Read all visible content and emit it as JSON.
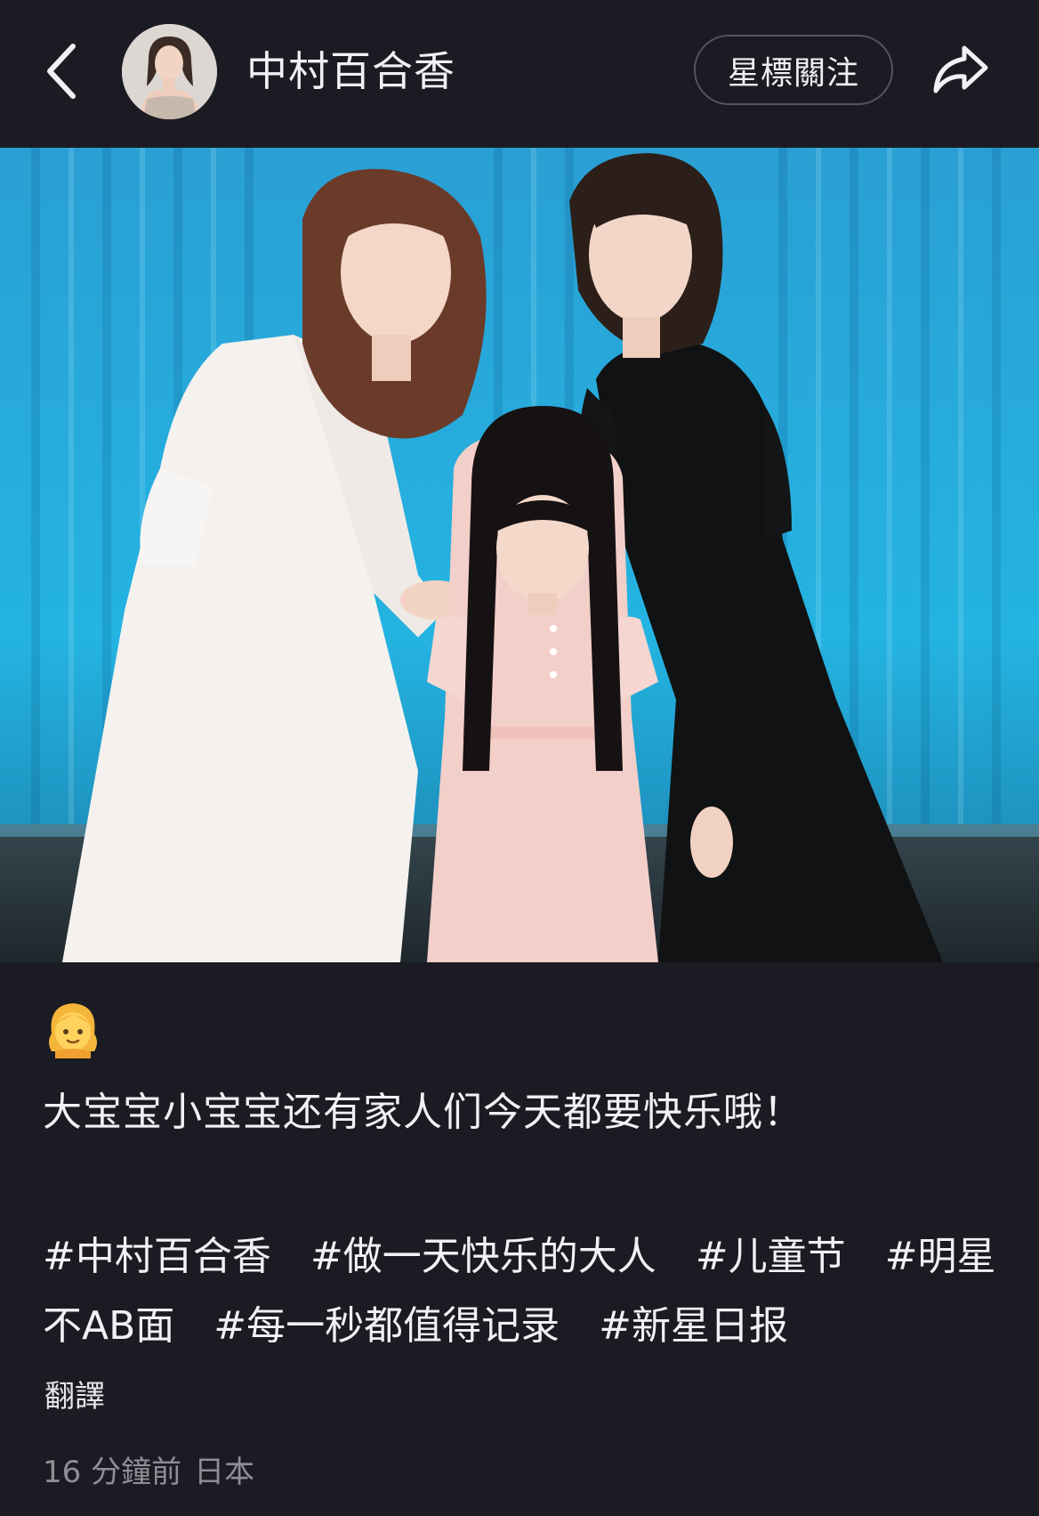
{
  "header": {
    "author_name": "中村百合香",
    "follow_label": "星標關注",
    "back_icon": "chevron-left-icon",
    "share_icon": "share-arrow-icon"
  },
  "post": {
    "emoji": "girl-emoji",
    "caption": "大宝宝小宝宝还有家人们今天都要快乐哦！",
    "tags": [
      "#中村百合香",
      "#做一天快乐的大人",
      "#儿童节",
      "#明星不AB面",
      "#每一秒都值得记录",
      "#新星日报"
    ],
    "translate_label": "翻譯",
    "time": "16 分鐘前",
    "location": "日本"
  },
  "colors": {
    "background": "#1b1b23",
    "curtain": "#21a6d8",
    "text": "#f1f1f4",
    "muted": "#8e8e96"
  }
}
